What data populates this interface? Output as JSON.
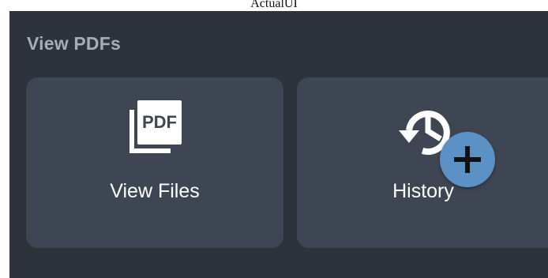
{
  "window": {
    "title": "ActualUI"
  },
  "section": {
    "title": "View PDFs"
  },
  "cards": [
    {
      "label": "View Files",
      "icon": "pdf-files-icon",
      "icon_text": "PDF"
    },
    {
      "label": "History",
      "icon": "history-icon"
    }
  ],
  "fab": {
    "icon": "plus-icon",
    "label": "+"
  },
  "colors": {
    "background": "#2d323b",
    "card": "#3f4653",
    "accent": "#5b91c4",
    "section_title": "#a7adb6",
    "text": "#ffffff"
  }
}
